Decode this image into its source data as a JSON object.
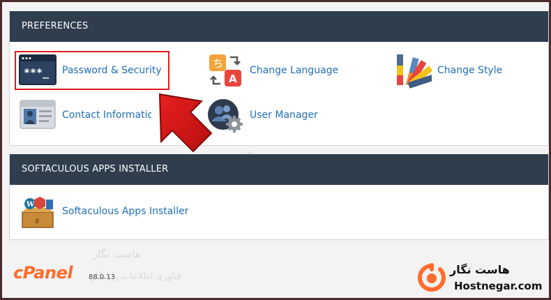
{
  "preferences": {
    "header": "PREFERENCES",
    "items": [
      {
        "label": "Password & Security",
        "icon": "password-security-icon"
      },
      {
        "label": "Change Language",
        "icon": "change-language-icon"
      },
      {
        "label": "Change Style",
        "icon": "change-style-icon"
      },
      {
        "label": "Contact Information",
        "icon": "contact-information-icon"
      },
      {
        "label": "User Manager",
        "icon": "user-manager-icon"
      }
    ]
  },
  "softaculous": {
    "header": "SOFTACULOUS APPS INSTALLER",
    "items": [
      {
        "label": "Softaculous Apps Installer",
        "icon": "softaculous-icon"
      }
    ]
  },
  "footer": {
    "logo": "cPanel",
    "version": "88.0.13",
    "brand_name": "هاست نگار",
    "brand_domain": "Hostnegar.com"
  },
  "watermark": {
    "name": "هاست نگار",
    "tagline": "فناوری اطلاعات رایانگار"
  },
  "colors": {
    "header_bg": "#2f3d4d",
    "link": "#1f6fb3",
    "highlight": "#e21a1a",
    "brand_orange": "#ff6c2c"
  }
}
